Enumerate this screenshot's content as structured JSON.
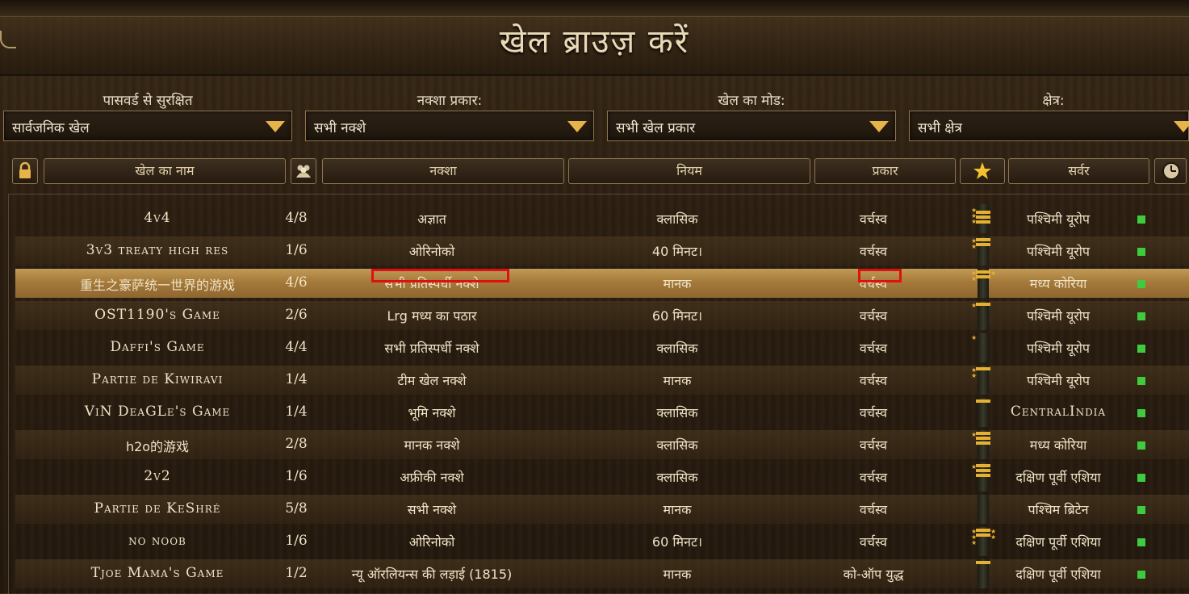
{
  "title": "खेल ब्राउज़ करें",
  "filters": [
    {
      "label": "पासवर्ड से सुरक्षित",
      "value": "सार्वजनिक खेल"
    },
    {
      "label": "नक्शा प्रकार:",
      "value": "सभी नक्शे"
    },
    {
      "label": "खेल का मोड:",
      "value": "सभी खेल प्रकार"
    },
    {
      "label": "क्षेत्र:",
      "value": "सभी क्षेत्र"
    }
  ],
  "columns": {
    "lock": "lock-icon",
    "name": "खेल का नाम",
    "players": "players-icon",
    "map": "नक्शा",
    "rules": "नियम",
    "type": "प्रकार",
    "rank": "star-icon",
    "server": "सर्वर",
    "ping": "clock-icon"
  },
  "colors": {
    "accent": "#e6b449",
    "selected_row": "#a57a3a",
    "ping_good": "#3ecb3e",
    "annotation": "#e01010"
  },
  "games": [
    {
      "name": "4v4",
      "players": "4/8",
      "map": "अज्ञात",
      "rules": "क्लासिक",
      "type": "वर्चस्व",
      "server": "पश्चिमी यूरोप"
    },
    {
      "name": "3v3 treaty high res",
      "players": "1/6",
      "map": "ओरिनोको",
      "rules": "40 मिनट।",
      "type": "वर्चस्व",
      "server": "पश्चिमी यूरोप"
    },
    {
      "name": "重生之豪萨统一世界的游戏",
      "players": "4/6",
      "map": "सभी प्रतिस्पर्धी नक्शे",
      "rules": "मानक",
      "type": "वर्चस्व",
      "server": "मध्य कोरिया"
    },
    {
      "name": "OST1190's Game",
      "players": "2/6",
      "map": "Lrg मध्य का पठार",
      "rules": "60 मिनट।",
      "type": "वर्चस्व",
      "server": "पश्चिमी यूरोप"
    },
    {
      "name": "Daffi's Game",
      "players": "4/4",
      "map": "सभी प्रतिस्पर्धी नक्शे",
      "rules": "क्लासिक",
      "type": "वर्चस्व",
      "server": "पश्चिमी यूरोप"
    },
    {
      "name": "Partie de Kiwiravi",
      "players": "1/4",
      "map": "टीम खेल नक्शे",
      "rules": "मानक",
      "type": "वर्चस्व",
      "server": "पश्चिमी यूरोप"
    },
    {
      "name": "ViN DeaGLe's Game",
      "players": "1/4",
      "map": "भूमि नक्शे",
      "rules": "क्लासिक",
      "type": "वर्चस्व",
      "server": "CentralIndia"
    },
    {
      "name": "h2o的游戏",
      "players": "2/8",
      "map": "मानक नक्शे",
      "rules": "क्लासिक",
      "type": "वर्चस्व",
      "server": "मध्य कोरिया"
    },
    {
      "name": "2v2",
      "players": "1/6",
      "map": "अफ्रीकी नक्शे",
      "rules": "क्लासिक",
      "type": "वर्चस्व",
      "server": "दक्षिण पूर्वी एशिया"
    },
    {
      "name": "Partie de KeShré",
      "players": "5/8",
      "map": "सभी नक्शे",
      "rules": "मानक",
      "type": "वर्चस्व",
      "server": "पश्चिम ब्रिटेन"
    },
    {
      "name": "no noob",
      "players": "1/6",
      "map": "ओरिनोको",
      "rules": "60 मिनट।",
      "type": "वर्चस्व",
      "server": "दक्षिण पूर्वी एशिया"
    },
    {
      "name": "Tjoe Mama's Game",
      "players": "1/2",
      "map": "न्यू ऑरलियन्स की लड़ाई (1815)",
      "rules": "मानक",
      "type": "को-ऑप युद्ध",
      "server": "दक्षिण पूर्वी एशिया"
    }
  ]
}
